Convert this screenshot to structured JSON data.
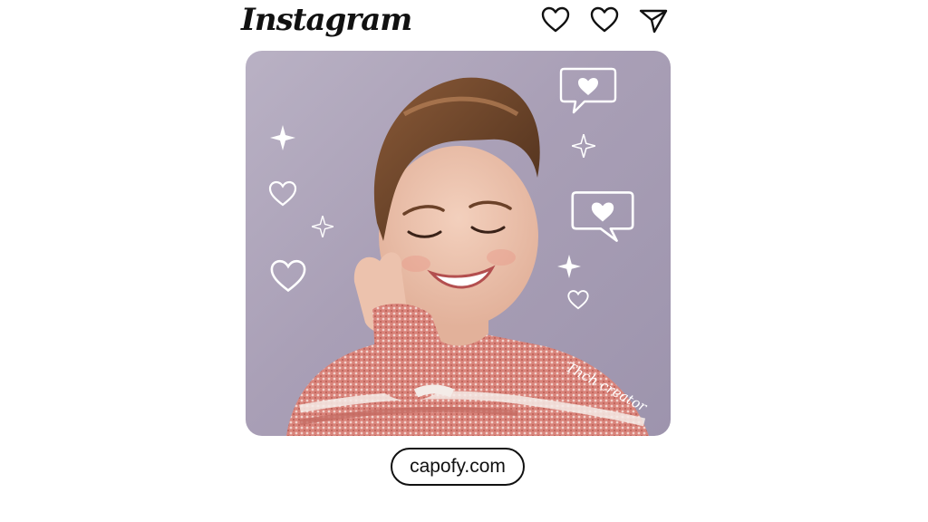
{
  "header": {
    "app_name": "Instagram",
    "icons": [
      "heart-icon",
      "heart-icon",
      "send-icon"
    ]
  },
  "post": {
    "image_subject": "smiling woman with short hair and knit sweater",
    "overlay_text": "Thch creator",
    "decorations": [
      "sparkle-icon",
      "heart-outline-icon",
      "heart-speech-bubble-icon"
    ]
  },
  "footer": {
    "site_label": "capofy.com"
  },
  "colors": {
    "background": "#ffffff",
    "post_bg": "#aaa0b8",
    "sweater": "#d97f76",
    "text": "#111111"
  }
}
